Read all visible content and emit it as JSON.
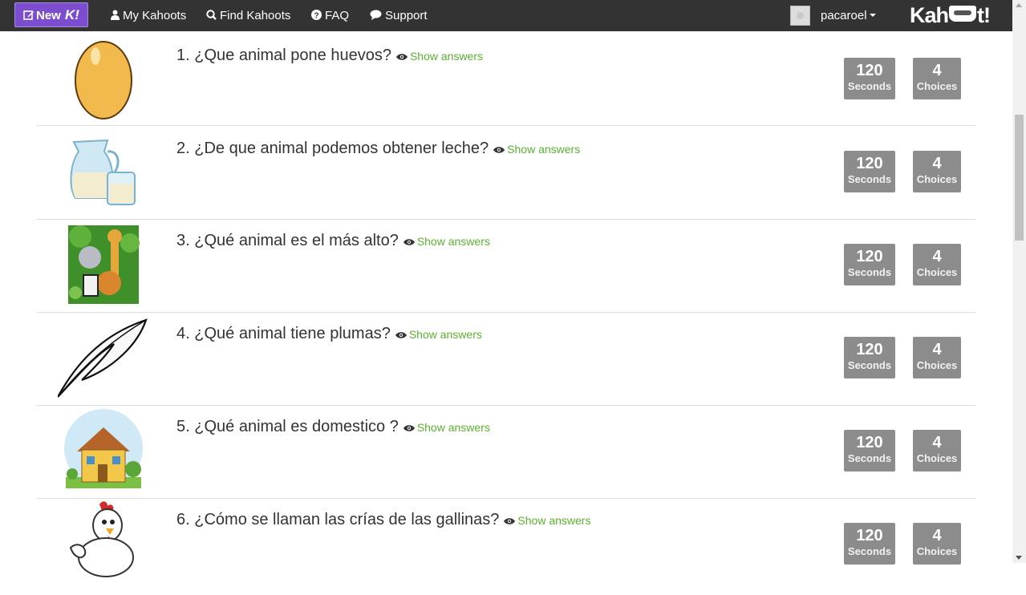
{
  "nav": {
    "new_label": "New",
    "new_k": "K!",
    "my_kahoots": "My Kahoots",
    "find_kahoots": "Find Kahoots",
    "faq": "FAQ",
    "support": "Support",
    "username": "pacaroel",
    "logo_text_left": "Kah",
    "logo_text_right": "t!"
  },
  "colors": {
    "navbar": "#333333",
    "new_button": "#7c4dce",
    "show_answers": "#5cb030",
    "badge": "#8c8c8c"
  },
  "questions": [
    {
      "number": "1.",
      "text": "¿Que animal pone huevos?",
      "show_answers": "Show answers",
      "time": "120",
      "time_unit": "Seconds",
      "choices": "4",
      "choices_label": "Choices",
      "image": "egg-image"
    },
    {
      "number": "2.",
      "text": "¿De que animal podemos obtener leche?",
      "show_answers": "Show answers",
      "time": "120",
      "time_unit": "Seconds",
      "choices": "4",
      "choices_label": "Choices",
      "image": "milk-jug-image"
    },
    {
      "number": "3.",
      "text": "¿Qué animal es el más alto?",
      "show_answers": "Show answers",
      "time": "120",
      "time_unit": "Seconds",
      "choices": "4",
      "choices_label": "Choices",
      "image": "jungle-animals-image"
    },
    {
      "number": "4.",
      "text": "¿Qué animal tiene plumas?",
      "show_answers": "Show answers",
      "time": "120",
      "time_unit": "Seconds",
      "choices": "4",
      "choices_label": "Choices",
      "image": "feather-image"
    },
    {
      "number": "5.",
      "text": "¿Qué animal es domestico ?",
      "show_answers": "Show answers",
      "time": "120",
      "time_unit": "Seconds",
      "choices": "4",
      "choices_label": "Choices",
      "image": "house-image"
    },
    {
      "number": "6.",
      "text": "¿Cómo se llaman las crías de las gallinas?",
      "show_answers": "Show answers",
      "time": "120",
      "time_unit": "Seconds",
      "choices": "4",
      "choices_label": "Choices",
      "image": "chicken-image"
    }
  ]
}
